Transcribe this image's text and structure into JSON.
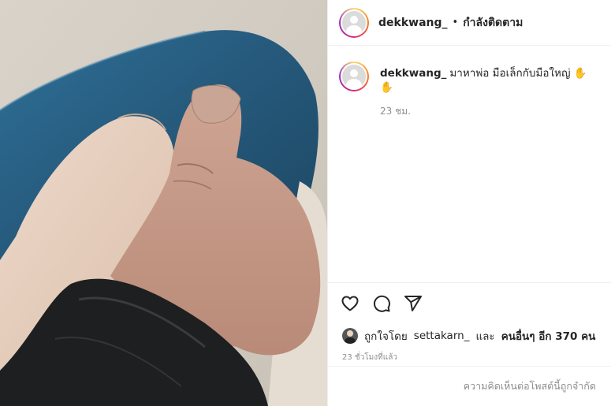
{
  "post": {
    "photo_alt": "hands photo",
    "username": "dekkwang_",
    "separator": "•",
    "follow_status": "กำลังติดตาม",
    "caption": {
      "username": "dekkwang_",
      "text": "มาหาพ่อ มือเล็กกับมือใหญ่ ✋✋",
      "time": "23 ชม."
    },
    "actions": {
      "like_icon": "heart-icon",
      "comment_icon": "comment-icon",
      "share_icon": "share-icon"
    },
    "likes": {
      "prefix": "ถูกใจโดย",
      "liker": "settakarn_",
      "joiner": "และ",
      "others": "คนอื่นๆ อีก 370 คน"
    },
    "posted_ago": "23 ชั่วโมงที่แล้ว",
    "comments_notice": "ความคิดเห็นต่อโพสต์นี้ถูกจำกัด"
  },
  "colors": {
    "border": "#efefef",
    "text": "#262626",
    "muted": "#8e8e8e"
  }
}
